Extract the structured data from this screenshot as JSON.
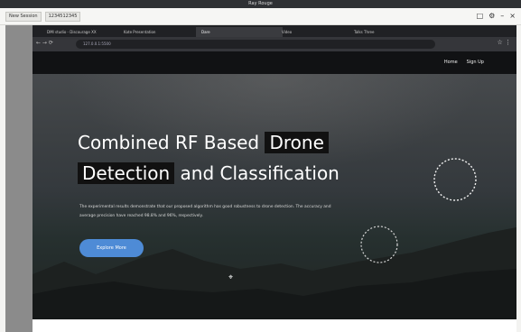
{
  "remote_window": {
    "title": "Ray Rouge",
    "toolbar_left": "New Session",
    "toolbar_field": "1234512345"
  },
  "browser": {
    "tabs": [
      {
        "label": "DMI studio - Discourage XX"
      },
      {
        "label": "Kate Presentation"
      },
      {
        "label": "Dare"
      },
      {
        "label": "Video"
      },
      {
        "label": "Talks Three"
      }
    ],
    "address": "127.0.0.1:5500"
  },
  "site": {
    "nav": [
      "Home",
      "Sign Up"
    ],
    "headline_parts": [
      "Combined RF Based",
      "Drone",
      "Detection",
      "and Classification"
    ],
    "description": "The experimental results demonstrate that our proposed algorithm has good robustness to drone detection. The accuracy and average precision have reached 98.8% and 96%, respectively.",
    "button_label": "Explore More"
  }
}
